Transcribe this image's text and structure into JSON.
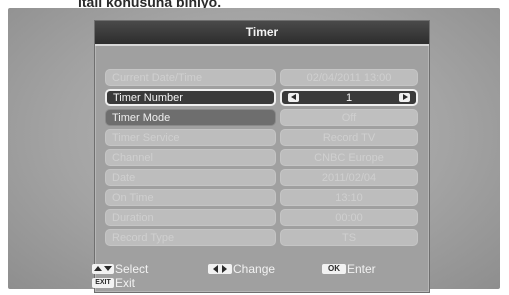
{
  "top_caption": "italı konusuna biniyo.",
  "title": "Timer",
  "rows": [
    {
      "label": "Current Date/Time",
      "value": "02/04/2011 13:00",
      "state": "disabled"
    },
    {
      "label": "Timer Number",
      "value": "1",
      "state": "active"
    },
    {
      "label": "Timer Mode",
      "value": "Off",
      "state": "normal"
    },
    {
      "label": "Timer Service",
      "value": "Record TV",
      "state": "disabled"
    },
    {
      "label": "Channel",
      "value": "CNBC Europe",
      "state": "disabled"
    },
    {
      "label": "Date",
      "value": "2011/02/04",
      "state": "disabled"
    },
    {
      "label": "On Time",
      "value": "13:10",
      "state": "disabled"
    },
    {
      "label": "Duration",
      "value": "00:00",
      "state": "disabled"
    },
    {
      "label": "Record Type",
      "value": "TS",
      "state": "disabled"
    }
  ],
  "footer": {
    "select_label": "Select",
    "change_label": "Change",
    "enter_label": "Enter",
    "exit_label": "Exit",
    "ok_key": "OK",
    "exit_key": "EXIT"
  },
  "icons": {
    "updown": "up-down-arrows-icon",
    "leftright": "left-right-arrows-icon",
    "ok": "ok-key-icon",
    "exit": "exit-key-icon"
  }
}
